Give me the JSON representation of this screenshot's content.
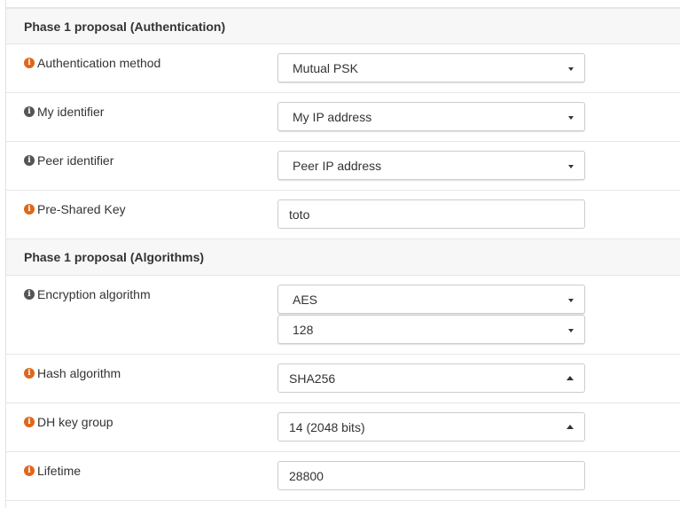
{
  "sections": [
    {
      "title": "Phase 1 proposal (Authentication)"
    },
    {
      "title": "Phase 1 proposal (Algorithms)"
    }
  ],
  "fields": {
    "auth_method": {
      "label": "Authentication method",
      "value": "Mutual PSK"
    },
    "my_identifier": {
      "label": "My identifier",
      "value": "My IP address"
    },
    "peer_identifier": {
      "label": "Peer identifier",
      "value": "Peer IP address"
    },
    "psk": {
      "label": "Pre-Shared Key",
      "value": "toto"
    },
    "encryption": {
      "label": "Encryption algorithm",
      "value": "AES",
      "key_length": "128"
    },
    "hash": {
      "label": "Hash algorithm",
      "value": "SHA256"
    },
    "dh_group": {
      "label": "DH key group",
      "value": "14 (2048 bits)"
    },
    "lifetime": {
      "label": "Lifetime",
      "value": "28800"
    }
  },
  "icons": {
    "info": "info-circle-icon"
  },
  "colors": {
    "info_orange": "#e0661a",
    "info_gray": "#555555"
  }
}
